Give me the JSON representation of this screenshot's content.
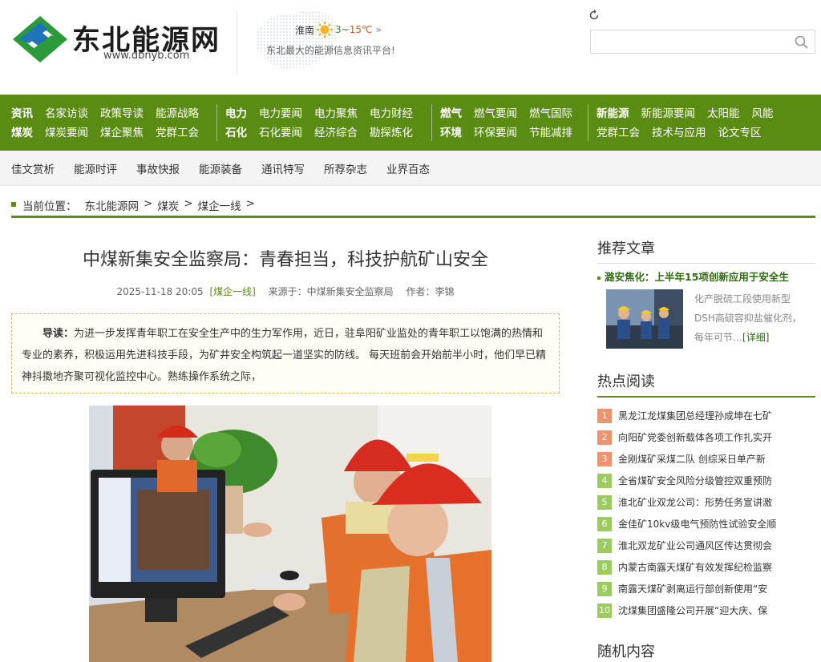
{
  "header": {
    "logo_text": "东北能源网",
    "logo_url": "www.dbnyb.com",
    "weather_city": "淮南",
    "weather_temp_low": "3",
    "weather_temp_sep": "~",
    "weather_temp_high": "15℃",
    "weather_more": "»",
    "slogan": "东北最大的能源信息资讯平台!",
    "search_placeholder": ""
  },
  "nav": {
    "groups": [
      {
        "rows": [
          [
            "资讯",
            "名家访谈",
            "政策导读",
            "能源战略"
          ],
          [
            "煤炭",
            "煤炭要闻",
            "煤企聚焦",
            "党群工会"
          ]
        ]
      },
      {
        "rows": [
          [
            "电力",
            "电力要闻",
            "电力聚焦",
            "电力财经"
          ],
          [
            "石化",
            "石化要闻",
            "经济综合",
            "勘探炼化"
          ]
        ]
      },
      {
        "rows": [
          [
            "燃气",
            "燃气要闻",
            "燃气国际"
          ],
          [
            "环境",
            "环保要闻",
            "节能减排"
          ]
        ]
      },
      {
        "rows": [
          [
            "新能源",
            "新能源要闻",
            "太阳能",
            "风能"
          ],
          [
            "党群工会",
            "技术与应用",
            "论文专区"
          ]
        ]
      }
    ],
    "sub": [
      "佳文赏析",
      "能源时评",
      "事故快报",
      "能源装备",
      "通讯特写",
      "所荐杂志",
      "业界百态"
    ]
  },
  "breadcrumb": {
    "label": "当前位置：",
    "items": [
      "东北能源网",
      "煤炭",
      "煤企一线"
    ],
    "sep": ">"
  },
  "article": {
    "title": "中煤新集安全监察局：青春担当，科技护航矿山安全",
    "date": "2025-11-18 20:05",
    "category": "[煤企一线]",
    "source_label": "来源于：",
    "source": "中煤新集安全监察局",
    "author_label": "作者：",
    "author": "李锦",
    "intro_lead": "导读：",
    "intro_text": "为进一步发挥青年职工在安全生产中的生力军作用，近日，驻阜阳矿业监处的青年职工以饱满的热情和专业的素养，积极运用先进科技手段，为矿井安全构筑起一道坚实的防线。 每天班前会开始前半小时，他们早已精神抖擞地齐聚可视化监控中心。熟练操作系统之际，"
  },
  "sidebar": {
    "recommend_title": "推荐文章",
    "rec_headline": "潞安焦化：上半年15项创新应用于安全生",
    "rec_summary": "化产脱硫工段使用新型DSH高硫容抑盐催化剂，每年可节…",
    "rec_more": "[详细]",
    "hot_title": "热点阅读",
    "hot": [
      "黑龙江龙煤集团总经理孙成坤在七矿",
      "向阳矿党委创新载体各项工作扎实开",
      "金刚煤矿采煤二队 创综采日单产新",
      "全省煤矿安全风险分级管控双重预防",
      "淮北矿业双龙公司：形势任务宣讲激",
      "金佳矿10kv级电气预防性试验安全顺",
      "淮北双龙矿业公司通风区传达贯彻会",
      "内蒙古南露天煤矿有效发挥纪检监察",
      "南露天煤矿剥离运行部创新使用“安",
      "沈煤集团盛隆公司开展“迎大庆、保"
    ],
    "random_title": "随机内容"
  },
  "colors": {
    "brand_green": "#5a8c14",
    "hot_top": "#f0926b",
    "hot_normal": "#9ccc5d"
  }
}
